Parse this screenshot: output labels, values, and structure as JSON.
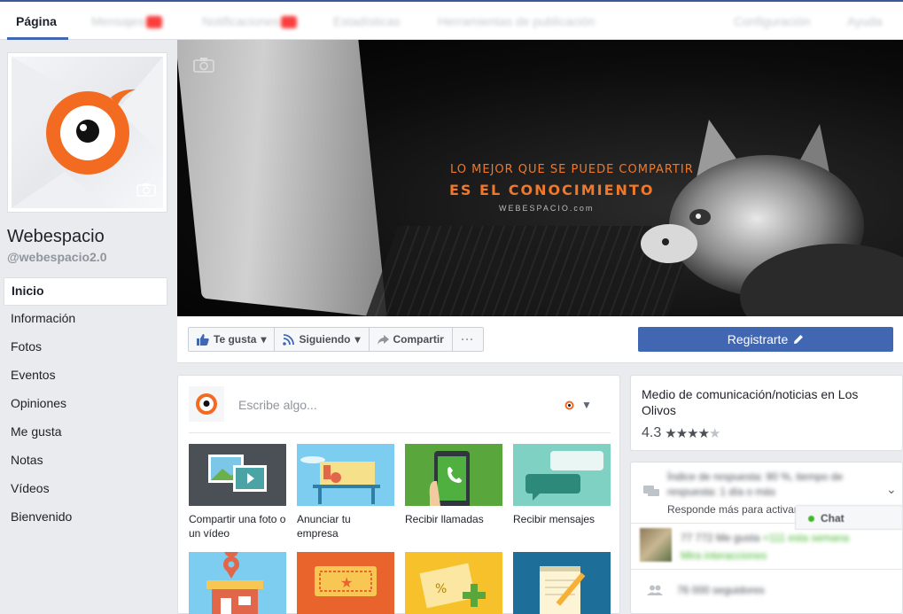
{
  "tabs": {
    "pagina": "Página",
    "mensajes": "Mensajes",
    "notificaciones": "Notificaciones",
    "estadisticas": "Estadísticas",
    "herramientas": "Herramientas de publicación",
    "configuracion": "Configuración",
    "ayuda": "Ayuda"
  },
  "page": {
    "name": "Webespacio",
    "handle": "@webespacio2.0"
  },
  "nav": [
    "Inicio",
    "Información",
    "Fotos",
    "Eventos",
    "Opiniones",
    "Me gusta",
    "Notas",
    "Vídeos",
    "Bienvenido"
  ],
  "cover": {
    "line1": "LO MEJOR QUE SE PUEDE COMPARTIR",
    "line2": "ES EL CONOCIMIENTO",
    "line3": "WEBESPACIO.com"
  },
  "actions": {
    "like": "Te gusta",
    "following": "Siguiendo",
    "share": "Compartir",
    "register": "Registrarte"
  },
  "composer": {
    "placeholder": "Escribe algo...",
    "tiles": [
      "Compartir una foto o un vídeo",
      "Anunciar tu empresa",
      "Recibir llamadas",
      "Recibir mensajes"
    ]
  },
  "about": {
    "category": "Medio de comunicación/noticias en Los Olivos",
    "rating": "4.3"
  },
  "responsiveness": {
    "blurred": "Índice de respuesta: 90 %, tiempo de respuesta: 1 día o más",
    "visible": "Responde más para activar"
  },
  "likes": {
    "count": "77 772 Me gusta",
    "weekly": "+111 esta semana",
    "friends": "Mira interacciones"
  },
  "followers": "76 000 seguidores",
  "chat": "Chat",
  "colors": {
    "accent": "#4267b2",
    "brand_orange": "#f0782a"
  }
}
